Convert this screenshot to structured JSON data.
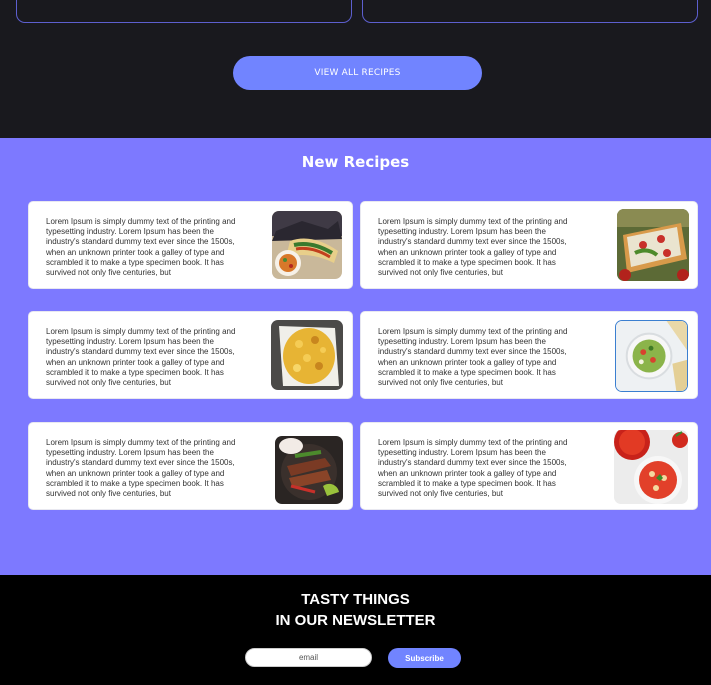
{
  "top_section": {
    "view_all_label": "VIEW ALL RECIPES"
  },
  "new_recipes": {
    "title": "New Recipes",
    "cards": [
      {
        "text": "Lorem Ipsum is simply dummy text of the printing and typesetting industry. Lorem Ipsum has been the industry's standard dummy text ever since the 1500s, when an unknown printer took a galley of type and scrambled it to make a type specimen book. It has survived not only five centuries, but",
        "image": "tacos-photo"
      },
      {
        "text": "Lorem Ipsum is simply dummy text of the printing and typesetting industry. Lorem Ipsum has been the industry's standard dummy text ever since the 1500s, when an unknown printer took a galley of type and scrambled it to make a type specimen book. It has survived not only five centuries, but",
        "image": "toast-photo"
      },
      {
        "text": "Lorem Ipsum is simply dummy text of the printing and typesetting industry. Lorem Ipsum has been the industry's standard dummy text ever since the 1500s, when an unknown printer took a galley of type and scrambled it to make a type specimen book. It has survived not only five centuries, but",
        "image": "mac-and-cheese-photo"
      },
      {
        "text": "Lorem Ipsum is simply dummy text of the printing and typesetting industry. Lorem Ipsum has been the industry's standard dummy text ever since the 1500s, when an unknown printer took a galley of type and scrambled it to make a type specimen book. It has survived not only five centuries, but",
        "image": "guacamole-photo"
      },
      {
        "text": "Lorem Ipsum is simply dummy text of the printing and typesetting industry. Lorem Ipsum has been the industry's standard dummy text ever since the 1500s, when an unknown printer took a galley of type and scrambled it to make a type specimen book. It has survived not only five centuries, but",
        "image": "fajitas-photo"
      },
      {
        "text": "Lorem Ipsum is simply dummy text of the printing and typesetting industry. Lorem Ipsum has been the industry's standard dummy text ever since the 1500s, when an unknown printer took a galley of type and scrambled it to make a type specimen book. It has survived not only five centuries, but",
        "image": "tomato-soup-photo"
      }
    ]
  },
  "newsletter": {
    "title_line1": "TASTY THINGS",
    "title_line2": "IN OUR NEWSLETTER",
    "email_placeholder": "email",
    "subscribe_label": "Subscribe"
  },
  "colors": {
    "dark_bg": "#19191e",
    "accent": "#7184ff",
    "section_bg": "#7d79ff",
    "card_outline": "#5d5fcf"
  }
}
